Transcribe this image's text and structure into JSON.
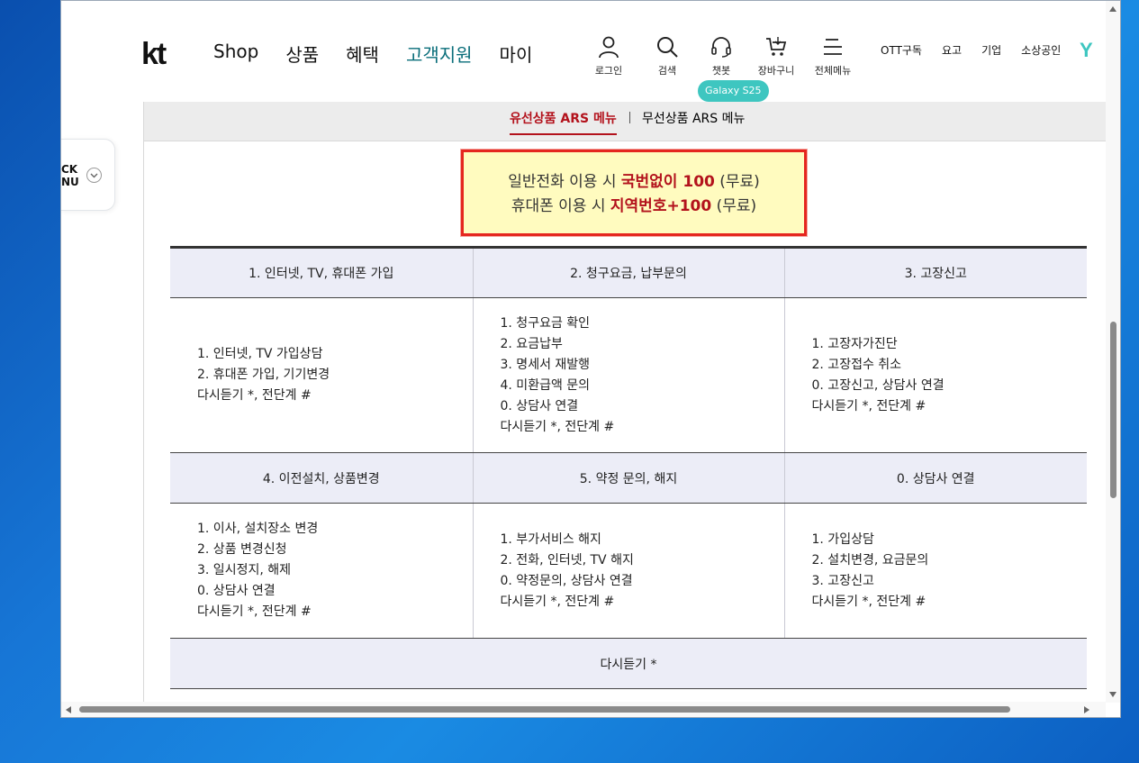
{
  "header": {
    "logo": "kt",
    "nav": [
      "Shop",
      "상품",
      "혜택",
      "고객지원",
      "마이"
    ],
    "active_nav": "고객지원",
    "utils": [
      {
        "label": "로그인",
        "icon": "user-icon"
      },
      {
        "label": "검색",
        "icon": "search-icon"
      },
      {
        "label": "챗봇",
        "icon": "headset-icon"
      },
      {
        "label": "장바구니",
        "icon": "cart-icon"
      },
      {
        "label": "전체메뉴",
        "icon": "menu-icon"
      }
    ],
    "badge": "Galaxy S25",
    "toplinks": [
      "OTT구독",
      "요고",
      "기업",
      "소상공인"
    ],
    "brand_icon": "Y"
  },
  "quickmenu": {
    "line1": "CK",
    "line2": "NU"
  },
  "tabs": {
    "active": "유선상품 ARS 메뉴",
    "inactive": "무선상품 ARS 메뉴"
  },
  "notice": {
    "line1_prefix": "일반전화 이용 시 ",
    "line1_strong": "국번없이 100",
    "line1_suffix": " (무료)",
    "line2_prefix": "휴대폰 이용 시 ",
    "line2_strong": "지역번호+100",
    "line2_suffix": " (무료)"
  },
  "ars": {
    "row1_headers": [
      "1. 인터넷, TV, 휴대폰 가입",
      "2. 청구요금, 납부문의",
      "3. 고장신고"
    ],
    "row1_cells": [
      [
        "1. 인터넷, TV 가입상담",
        "2. 휴대폰 가입, 기기변경",
        "다시듣기 *, 전단계 #"
      ],
      [
        "1. 청구요금 확인",
        "2. 요금납부",
        "3. 명세서 재발행",
        "4. 미환급액 문의",
        "0. 상담사 연결",
        "다시듣기 *, 전단계 #"
      ],
      [
        "1. 고장자가진단",
        "2. 고장접수 취소",
        "0. 고장신고, 상담사 연결",
        "다시듣기 *, 전단계 #"
      ]
    ],
    "row2_headers": [
      "4. 이전설치, 상품변경",
      "5. 약정 문의, 해지",
      "0. 상담사 연결"
    ],
    "row2_cells": [
      [
        "1. 이사, 설치장소 변경",
        "2. 상품 변경신청",
        "3. 일시정지, 해제",
        "0. 상담사 연결",
        "다시듣기 *, 전단계 #"
      ],
      [
        "1. 부가서비스 해지",
        "2. 전화, 인터넷, TV 해지",
        "0. 약정문의, 상담사 연결",
        "다시듣기 *, 전단계 #"
      ],
      [
        "1. 가입상담",
        "2. 설치변경, 요금문의",
        "3. 고장신고",
        "다시듣기 *, 전단계 #"
      ]
    ],
    "footer": "다시듣기 *"
  },
  "colors": {
    "accent_red": "#b3121c",
    "brand_teal": "#3ec6c0",
    "active_nav": "#0a6e7a"
  }
}
